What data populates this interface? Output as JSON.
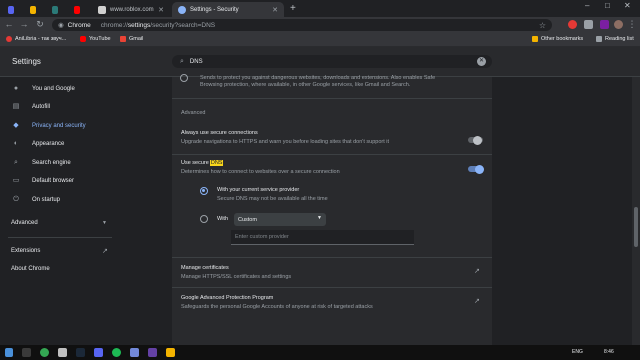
{
  "browser": {
    "tabs": [
      {
        "label": "",
        "icon": "discord-icon",
        "color": "#5865f2"
      },
      {
        "label": "",
        "icon": "sheet-icon",
        "color": "#f4b400"
      },
      {
        "label": "",
        "icon": "app-icon",
        "color": "#2b7a78"
      },
      {
        "label": "",
        "icon": "youtube-icon",
        "color": "#ff0000"
      },
      {
        "label": "www.roblox.com",
        "icon": "roblox-icon"
      },
      {
        "label": "Settings - Security",
        "icon": "gear-icon"
      }
    ],
    "address_scheme": "Chrome",
    "address_host": "chrome://",
    "address_path_bold": "settings",
    "address_rest": "/security?search=DNS",
    "window_controls": [
      "–",
      "□",
      "✕"
    ]
  },
  "bookmarks": {
    "items": [
      {
        "label": "AniLibria - так звуч...",
        "color": "#e53935"
      },
      {
        "label": "YouTube",
        "color": "#ff0000"
      },
      {
        "label": "Gmail",
        "color": "#ea4335"
      }
    ],
    "other": "Other bookmarks",
    "reading_list": "Reading list"
  },
  "settings": {
    "title": "Settings",
    "search_value": "DNS"
  },
  "sidebar": {
    "items": [
      {
        "label": "You and Google",
        "icon": "person-icon"
      },
      {
        "label": "Autofill",
        "icon": "clipboard-icon"
      },
      {
        "label": "Privacy and security",
        "icon": "shield-icon"
      },
      {
        "label": "Appearance",
        "icon": "palette-icon"
      },
      {
        "label": "Search engine",
        "icon": "search-icon"
      },
      {
        "label": "Default browser",
        "icon": "browser-icon"
      },
      {
        "label": "On startup",
        "icon": "power-icon"
      }
    ],
    "advanced": "Advanced",
    "extensions": "Extensions",
    "about": "About Chrome"
  },
  "main": {
    "top_text_1": "Sends to protect you against dangerous websites, downloads and extensions. Also enables Safe",
    "top_text_2": "Browsing protection, where available, in other Google services, like Gmail and Search.",
    "section_advanced": "Advanced",
    "https_title": "Always use secure connections",
    "https_desc": "Upgrade navigations to HTTPS and warn you before loading sites that don't support it",
    "dns_title_prefix": "Use secure ",
    "dns_title_highlight": "DNS",
    "dns_desc": "Determines how to connect to websites over a secure connection",
    "option1_title": "With your current service provider",
    "option1_desc": "Secure DNS may not be available all the time",
    "option2_label": "With",
    "provider_selected": "Custom",
    "custom_placeholder": "Enter custom provider",
    "certs_title": "Manage certificates",
    "certs_desc": "Manage HTTPS/SSL certificates and settings",
    "gap_title": "Google Advanced Protection Program",
    "gap_desc": "Safeguards the personal Google Accounts of anyone at risk of targeted attacks"
  },
  "taskbar": {
    "lang": "ENG",
    "time": "8:46"
  },
  "colors": {
    "accent": "#8ab4f8",
    "highlight": "#f9d71c"
  }
}
